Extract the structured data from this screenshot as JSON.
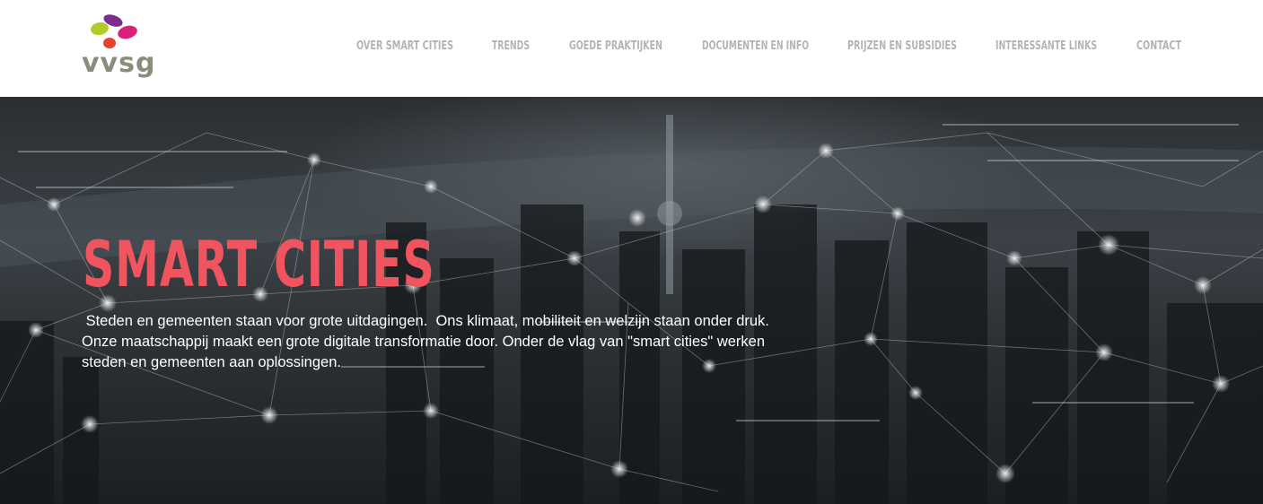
{
  "header": {
    "logo_text": "vvsg",
    "logo_colors": [
      "#b6c928",
      "#7b2d8e",
      "#d8217a",
      "#e8412c"
    ]
  },
  "nav": {
    "items": [
      {
        "label": "OVER SMART CITIES"
      },
      {
        "label": "TRENDS"
      },
      {
        "label": "GOEDE PRAKTIJKEN"
      },
      {
        "label": "DOCUMENTEN EN INFO"
      },
      {
        "label": "PRIJZEN EN SUBSIDIES"
      },
      {
        "label": "INTERESSANTE LINKS"
      },
      {
        "label": "CONTACT"
      }
    ]
  },
  "hero": {
    "title": "SMART CITIES",
    "text": " Steden en gemeenten staan voor grote uitdagingen.  Ons klimaat, mobiliteit en welzijn staan onder druk.\nOnze maatschappij maakt een grote digitale transformatie door. Onder de vlag van \"smart cities\" werken\nsteden en gemeenten aan oplossingen.",
    "title_color": "#f0555f"
  }
}
